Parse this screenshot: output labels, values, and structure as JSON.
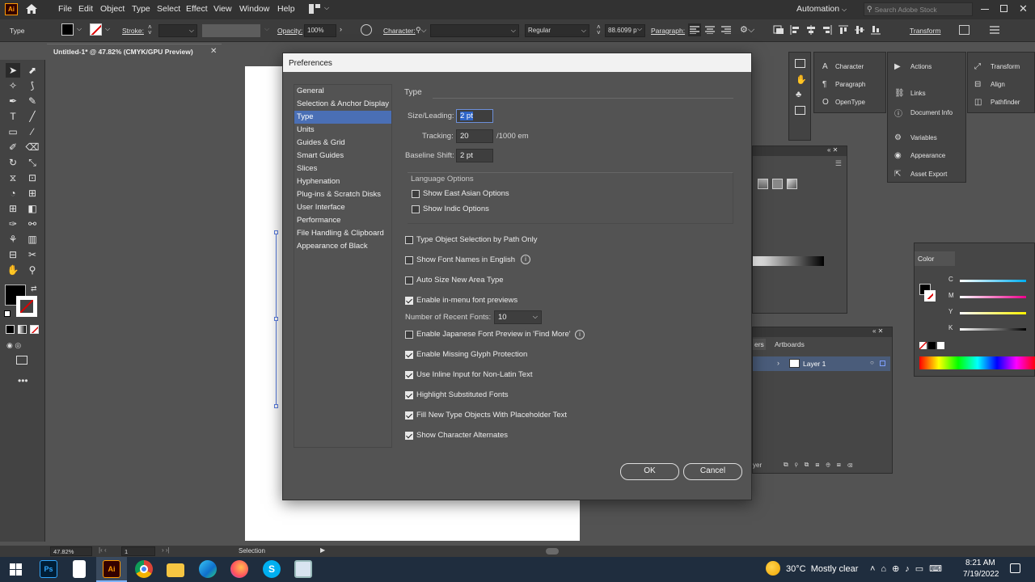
{
  "app": {
    "logo": "Ai",
    "menu": [
      "File",
      "Edit",
      "Object",
      "Type",
      "Select",
      "Effect",
      "View",
      "Window",
      "Help"
    ],
    "workspace": "Automation",
    "search_placeholder": "Search Adobe Stock"
  },
  "control": {
    "type_label": "Type",
    "stroke_label": "Stroke:",
    "opacity_label": "Opacity:",
    "opacity_value": "100%",
    "character_label": "Character:",
    "font_style": "Regular",
    "font_size": "88.6099 p",
    "paragraph_label": "Paragraph:",
    "transform_label": "Transform"
  },
  "doc": {
    "tab_title": "Untitled-1* @ 47.82% (CMYK/GPU Preview)"
  },
  "panels": {
    "col1": [
      "Character",
      "Paragraph",
      "OpenType"
    ],
    "col2": [
      "Actions",
      "Links",
      "Document Info",
      "Variables",
      "Appearance",
      "Asset Export"
    ],
    "col3": [
      "Transform",
      "Align",
      "Pathfinder"
    ],
    "color_title": "Color",
    "color_channels": [
      "C",
      "M",
      "Y",
      "K"
    ],
    "layers_tabs": [
      "ers",
      "Artboards"
    ],
    "layer_name": "Layer 1",
    "layers_footer": "yer"
  },
  "dialog": {
    "title": "Preferences",
    "categories": [
      "General",
      "Selection & Anchor Display",
      "Type",
      "Units",
      "Guides & Grid",
      "Smart Guides",
      "Slices",
      "Hyphenation",
      "Plug-ins & Scratch Disks",
      "User Interface",
      "Performance",
      "File Handling & Clipboard",
      "Appearance of Black"
    ],
    "section": "Type",
    "size_leading_label": "Size/Leading:",
    "size_leading_value": "2 pt",
    "tracking_label": "Tracking:",
    "tracking_value": "20",
    "tracking_unit": "/1000 em",
    "baseline_label": "Baseline Shift:",
    "baseline_value": "2 pt",
    "lang_title": "Language Options",
    "lang_opts": [
      {
        "label": "Show East Asian Options",
        "checked": false
      },
      {
        "label": "Show Indic Options",
        "checked": false
      }
    ],
    "opts1": [
      {
        "label": "Type Object Selection by Path Only",
        "checked": false
      },
      {
        "label": "Show Font Names in English",
        "checked": false
      },
      {
        "label": "Auto Size New Area Type",
        "checked": false
      },
      {
        "label": "Enable in-menu font previews",
        "checked": true
      }
    ],
    "recent_label": "Number of Recent Fonts:",
    "recent_value": "10",
    "opts2": [
      {
        "label": "Enable Japanese Font Preview in 'Find More'",
        "checked": false
      },
      {
        "label": "Enable Missing Glyph Protection",
        "checked": true
      },
      {
        "label": "Use Inline Input for Non-Latin Text",
        "checked": true
      },
      {
        "label": "Highlight Substituted Fonts",
        "checked": true
      },
      {
        "label": "Fill New Type Objects With Placeholder Text",
        "checked": true
      },
      {
        "label": "Show Character Alternates",
        "checked": true
      }
    ],
    "ok": "OK",
    "cancel": "Cancel"
  },
  "status": {
    "zoom": "47.82%",
    "page": "1",
    "mode": "Selection"
  },
  "taskbar": {
    "weather": "30°C  Mostly clear",
    "time": "8:21 AM",
    "date": "7/19/2022",
    "apps": [
      "Ps",
      "file",
      "Ai",
      "chrome",
      "folder",
      "edge",
      "firefox",
      "skype",
      "app"
    ]
  },
  "colors": {
    "accent": "#4a6fb5",
    "dialog_bg": "#535353",
    "panel_bg": "#434343"
  }
}
